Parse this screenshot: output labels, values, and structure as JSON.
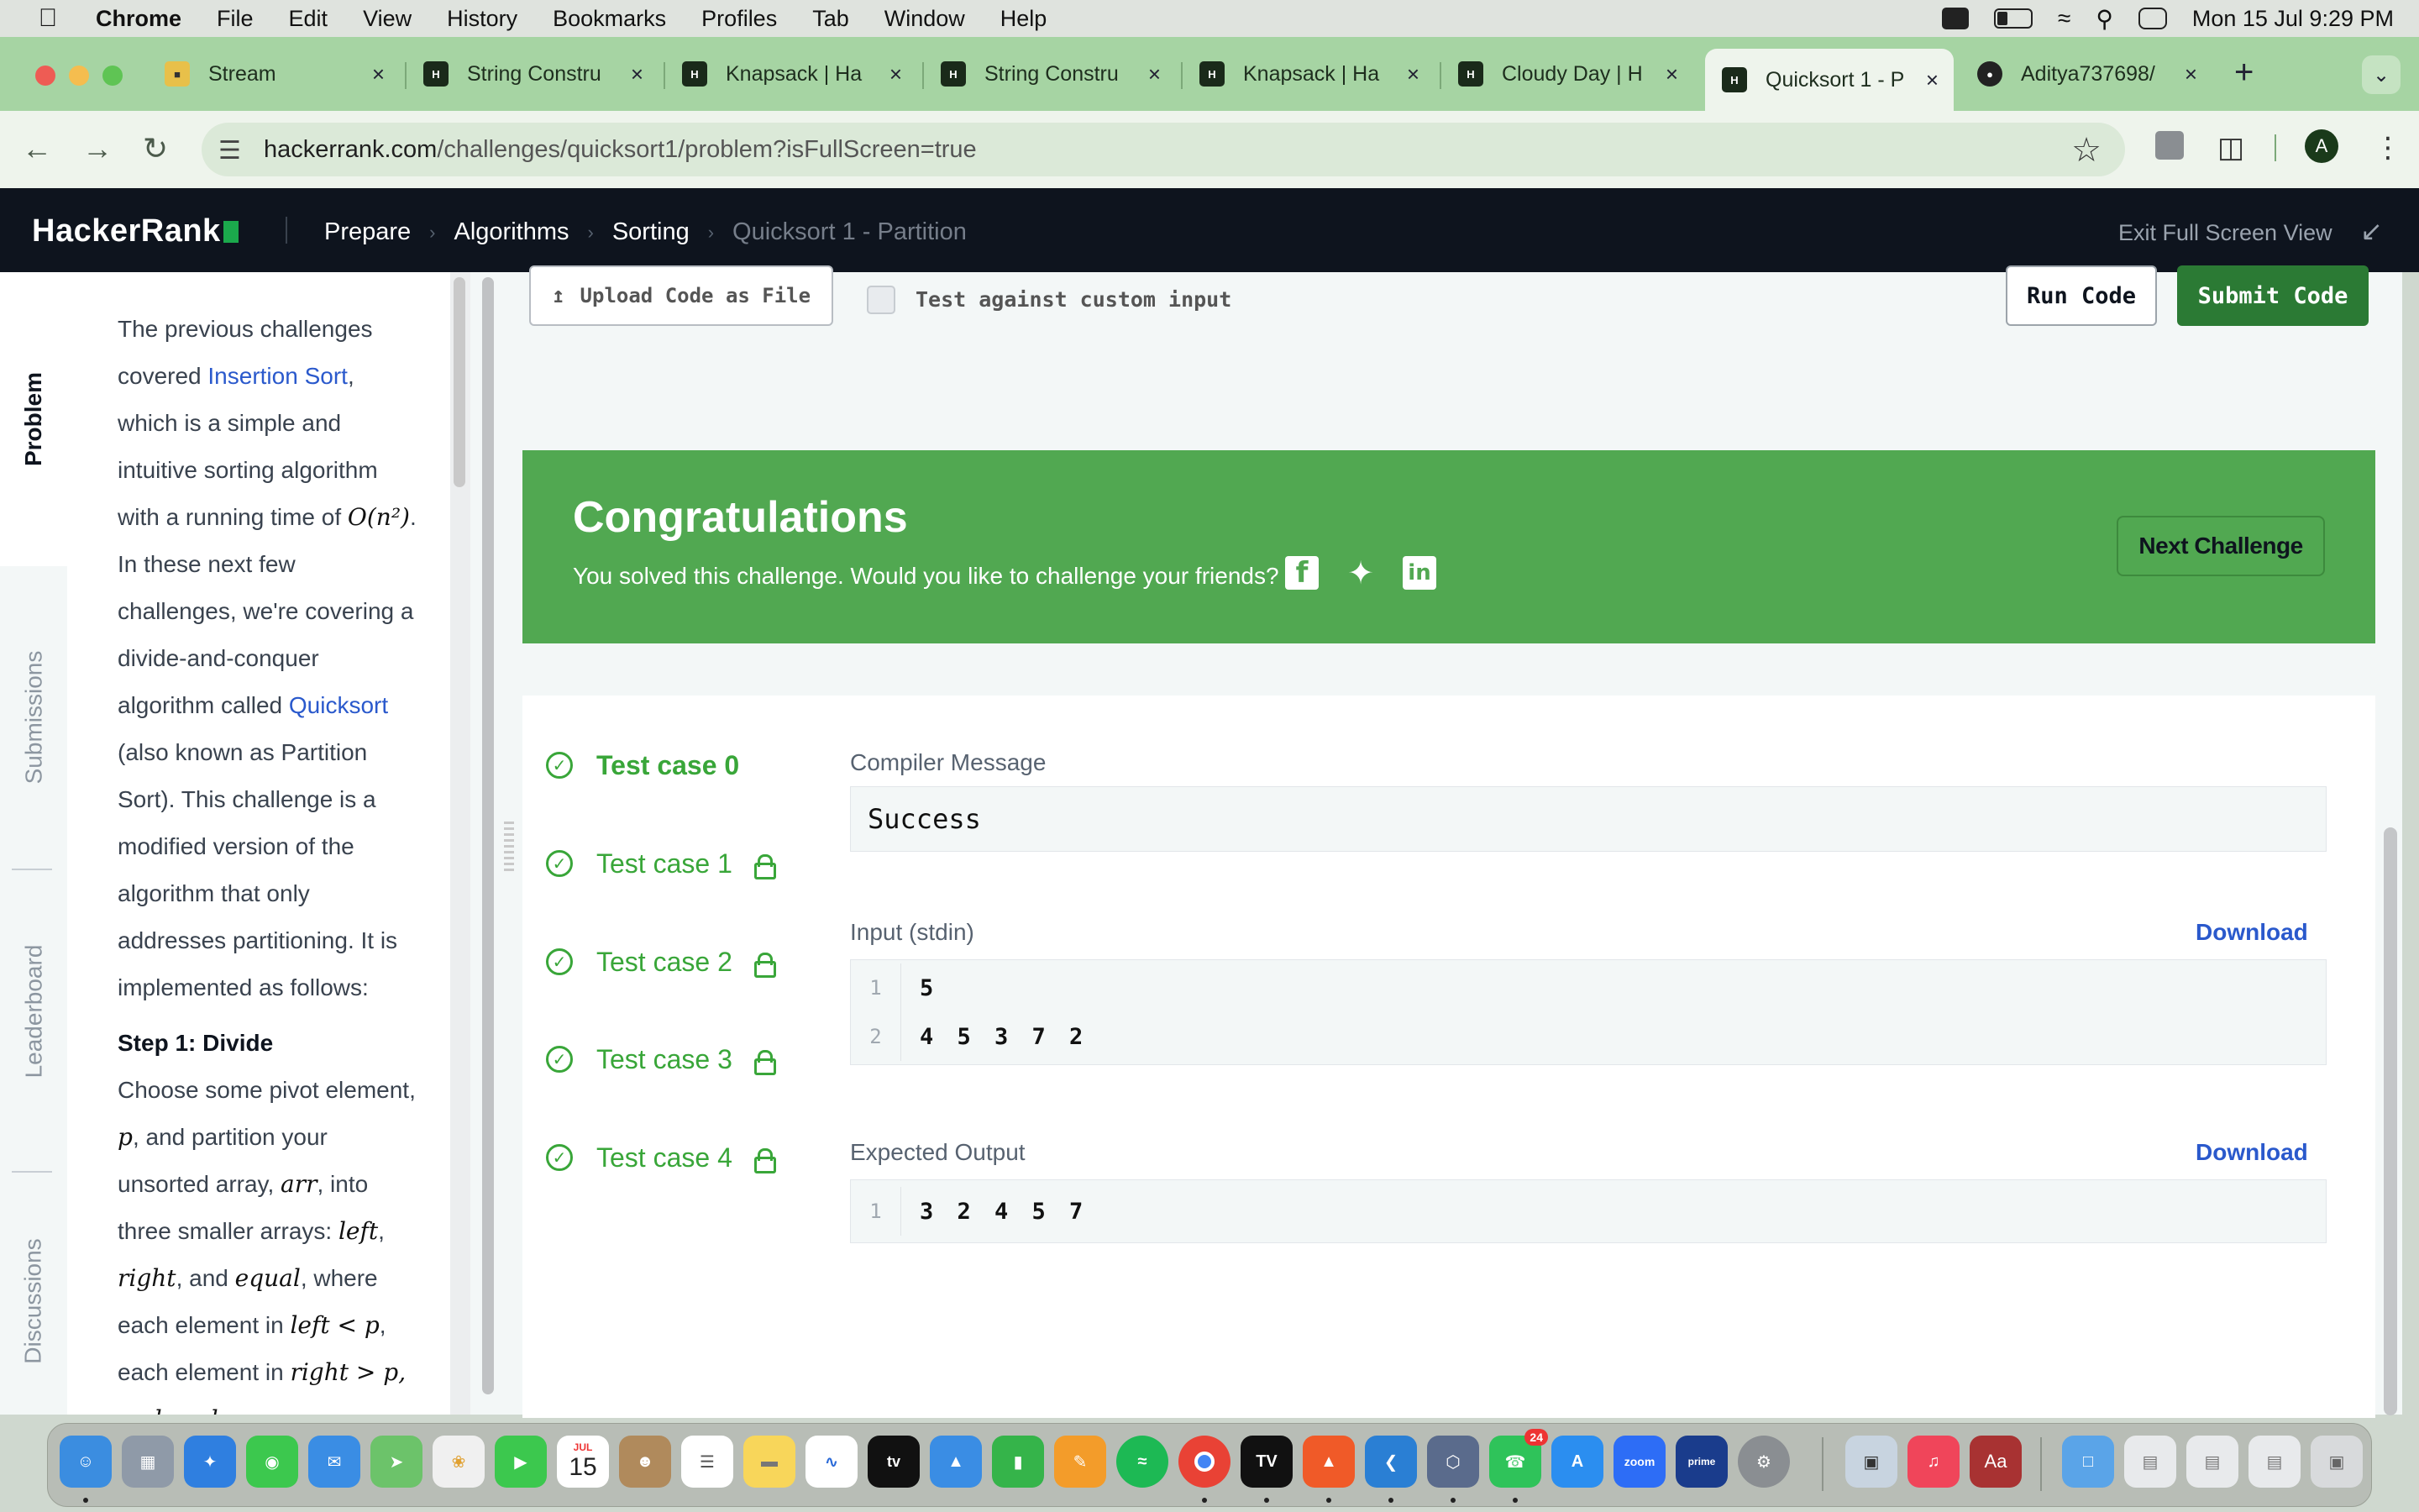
{
  "menubar": {
    "app": "Chrome",
    "items": [
      "File",
      "Edit",
      "View",
      "History",
      "Bookmarks",
      "Profiles",
      "Tab",
      "Window",
      "Help"
    ],
    "clock": "Mon 15 Jul  9:29 PM"
  },
  "tabs": [
    {
      "title": "Stream",
      "active": false
    },
    {
      "title": "String Constru",
      "active": false
    },
    {
      "title": "Knapsack | Ha",
      "active": false
    },
    {
      "title": "String Constru",
      "active": false
    },
    {
      "title": "Knapsack | Ha",
      "active": false
    },
    {
      "title": "Cloudy Day | H",
      "active": false
    },
    {
      "title": "Quicksort 1 - P",
      "active": true
    },
    {
      "title": "Aditya737698/",
      "active": false
    }
  ],
  "address": {
    "domain": "hackerrank.com",
    "path": "/challenges/quicksort1/problem?isFullScreen=true"
  },
  "profile_initial": "A",
  "hrnav": {
    "logo": "HackerRank",
    "breadcrumbs": [
      "Prepare",
      "Algorithms",
      "Sorting",
      "Quicksort 1 - Partition"
    ],
    "exit_label": "Exit Full Screen View"
  },
  "rail": {
    "problem": "Problem",
    "submissions": "Submissions",
    "leaderboard": "Leaderboard",
    "discussions": "Discussions"
  },
  "problem": {
    "p1_a": "The previous challenges covered ",
    "p1_link1": "Insertion Sort",
    "p1_b": ", which is a simple and intuitive sorting algorithm with a running time of ",
    "p1_math": "O(n²)",
    "p1_c": ". In these next few challenges, we're covering a divide-and-conquer algorithm called ",
    "p1_link2": "Quicksort",
    "p1_d": " (also known as Partition Sort). This challenge is a modified version of the algorithm that only addresses partitioning. It is implemented as follows:",
    "step1": "Step 1: Divide",
    "s1_a": "Choose some pivot element, ",
    "s1_p": "p",
    "s1_b": ", and partition your unsorted array, ",
    "s1_arr": "arr",
    "s1_c": ", into three smaller arrays: ",
    "s1_left": "left",
    "s1_comma": ", ",
    "s1_right": "right",
    "s1_and": ", and ",
    "s1_equal": "equal",
    "s1_d": ", where each element in ",
    "s1_cond": "left < p",
    "s1_e": ", each element in",
    "s1_cut": "right > p, and each"
  },
  "editor_actions": {
    "upload": "Upload Code as File",
    "custom_input": "Test against custom input",
    "run": "Run Code",
    "submit": "Submit Code"
  },
  "congrats": {
    "title": "Congratulations",
    "message": "You solved this challenge. Would you like to challenge your friends?",
    "next": "Next Challenge"
  },
  "test_cases": [
    {
      "label": "Test case 0",
      "locked": false,
      "active": true
    },
    {
      "label": "Test case 1",
      "locked": true,
      "active": false
    },
    {
      "label": "Test case 2",
      "locked": true,
      "active": false
    },
    {
      "label": "Test case 3",
      "locked": true,
      "active": false
    },
    {
      "label": "Test case 4",
      "locked": true,
      "active": false
    }
  ],
  "result": {
    "compiler_label": "Compiler Message",
    "compiler_message": "Success",
    "input_label": "Input (stdin)",
    "input_lines": [
      {
        "n": "1",
        "text": "5"
      },
      {
        "n": "2",
        "text": "4 5 3 7 2"
      }
    ],
    "expected_label": "Expected Output",
    "expected_lines": [
      {
        "n": "1",
        "text": "3 2 4 5 7"
      }
    ],
    "download": "Download"
  },
  "dock": {
    "calendar_month": "JUL",
    "calendar_day": "15",
    "whatsapp_badge": "24"
  },
  "colors": {
    "hr_dark": "#0e141e",
    "hr_green": "#1ba94c",
    "success_banner": "#51a851",
    "pass_green": "#39a639",
    "link_blue": "#2a59cc"
  }
}
